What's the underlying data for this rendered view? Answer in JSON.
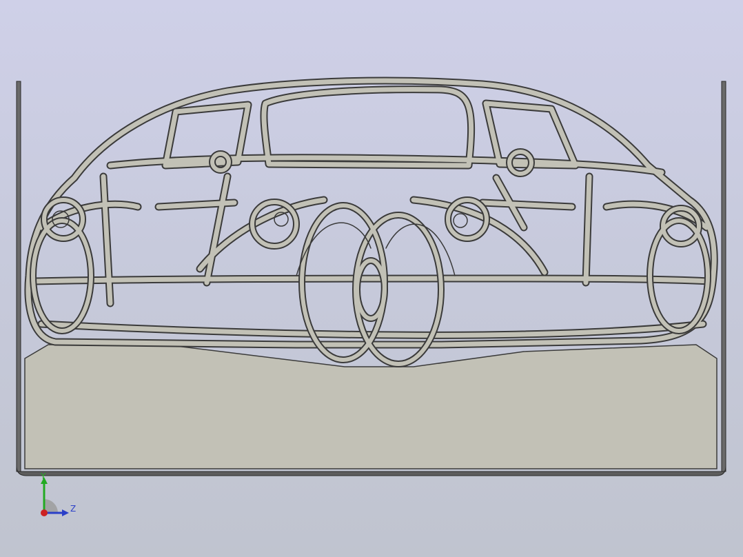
{
  "viewport": {
    "background_top": "#cfd0e8",
    "background_bottom": "#c0c4cf"
  },
  "model": {
    "part_fill": "#c2c1b6",
    "edge_color": "#3a3a3a",
    "depiction": "car-silhouette-wireframe-plate"
  },
  "triad": {
    "y_label": "Y",
    "z_label": "Z",
    "y_color": "#22aa22",
    "z_color": "#2a3fc8",
    "x_color": "#cc2222"
  }
}
